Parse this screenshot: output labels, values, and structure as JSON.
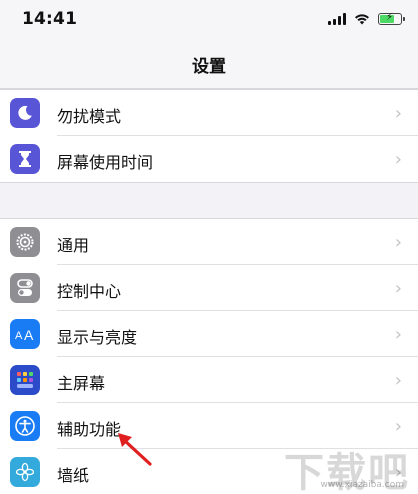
{
  "status_bar": {
    "time": "14:41",
    "icons": [
      "signal-icon",
      "wifi-icon",
      "battery-charging-icon"
    ]
  },
  "nav": {
    "title": "设置"
  },
  "group1": {
    "items": [
      {
        "label": "勿扰模式",
        "icon": "moon-icon",
        "color": "#5856d6"
      },
      {
        "label": "屏幕使用时间",
        "icon": "hourglass-icon",
        "color": "#5856d6"
      }
    ]
  },
  "group2": {
    "items": [
      {
        "label": "通用",
        "icon": "gear-icon",
        "color": "#8e8e93"
      },
      {
        "label": "控制中心",
        "icon": "toggles-icon",
        "color": "#8e8e93"
      },
      {
        "label": "显示与亮度",
        "icon": "text-size-icon",
        "color": "#1a7cf5"
      },
      {
        "label": "主屏幕",
        "icon": "home-screen-grid-icon",
        "color": "#2b4bc8"
      },
      {
        "label": "辅助功能",
        "icon": "accessibility-icon",
        "color": "#1a7cf5"
      },
      {
        "label": "墙纸",
        "icon": "flower-icon",
        "color": "#34aadc"
      }
    ]
  },
  "chevron": "›",
  "watermark": {
    "text": "下载吧",
    "url": "www.xiazaiba.com"
  },
  "colors": {
    "background": "#f2f2f7",
    "arrow": "#e02020"
  }
}
